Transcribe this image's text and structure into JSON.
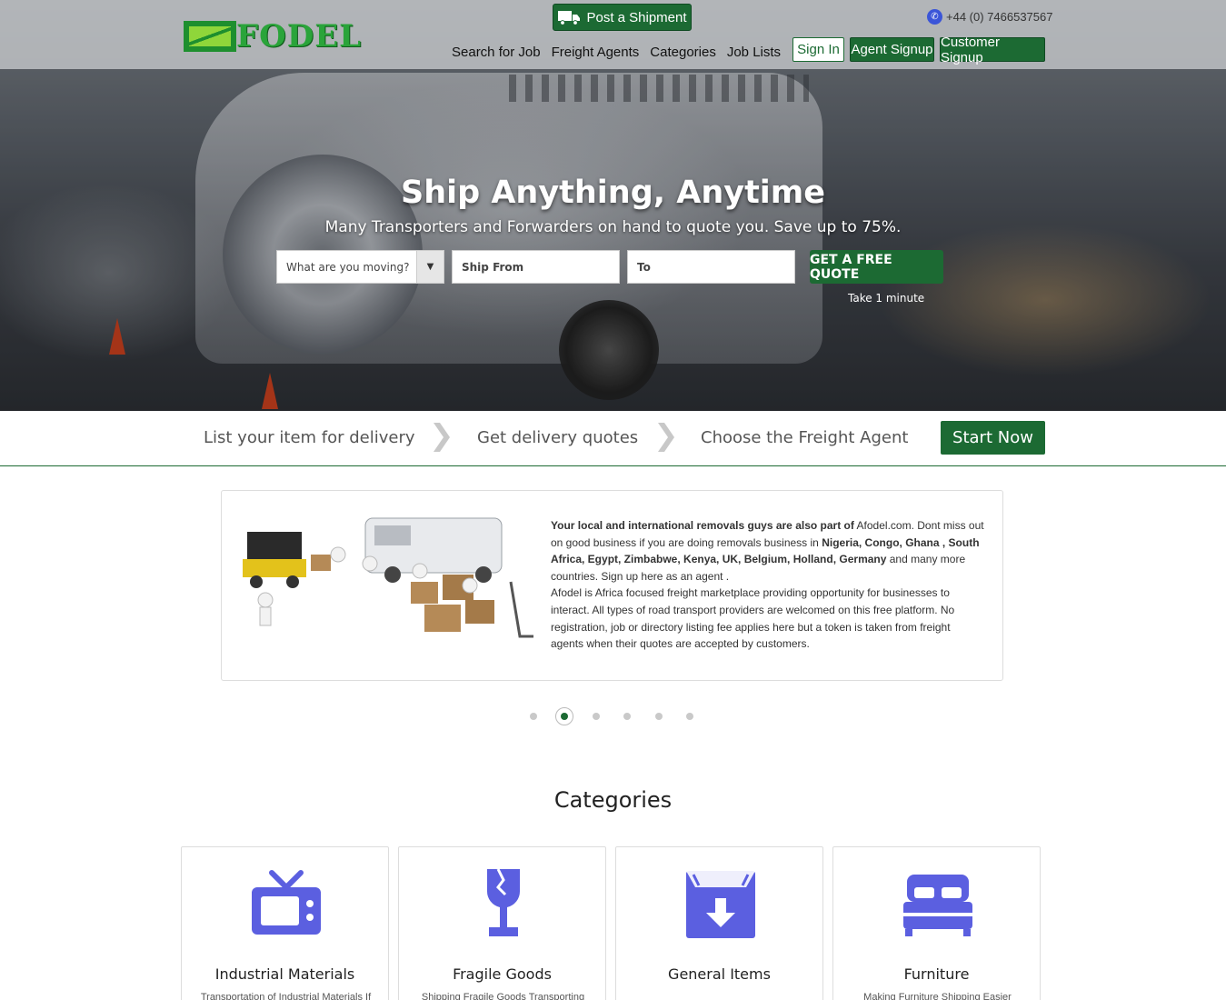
{
  "brand": {
    "logo_text": "FODEL"
  },
  "header": {
    "post_shipment_label": "Post a Shipment",
    "phone": "+44 (0) 7466537567",
    "nav": [
      "Search for Job",
      "Freight Agents",
      "Categories",
      "Job Lists"
    ],
    "sign_in": "Sign In",
    "agent_signup": "Agent Signup",
    "customer_signup": "Customer Signup"
  },
  "hero": {
    "title": "Ship Anything, Anytime",
    "subtitle": "Many Transporters and Forwarders on hand to quote you. Save up to 75%.",
    "moving_select": "What are you moving?",
    "ship_from_placeholder": "Ship From",
    "to_placeholder": "To",
    "quote_button": "GET A FREE QUOTE",
    "take_note": "Take 1 minute"
  },
  "steps": {
    "items": [
      "List your item for delivery",
      "Get delivery quotes",
      "Choose the Freight Agent"
    ],
    "start_button": "Start Now"
  },
  "carousel": {
    "para1_bold_a": "Your local and international removals guys are also part of",
    "para1_a": " Afodel.com. Dont miss out on good business if you are doing removals business in ",
    "para1_bold_b": "Nigeria, Congo, Ghana , South Africa, Egypt, Zimbabwe, Kenya, UK, Belgium, Holland, Germany",
    "para1_b": " and many more countries. Sign up here as an agent .",
    "para2": "Afodel is Africa focused freight marketplace providing opportunity for businesses to interact. All types of road transport providers are welcomed on this free platform. No registration, job or directory listing fee applies here but a token is taken from freight agents when their quotes are accepted by customers.",
    "slide_count": 6,
    "active_slide": 2
  },
  "categories": {
    "heading": "Categories",
    "items": [
      {
        "name": "Industrial Materials",
        "desc": "Transportation of Industrial Materials If",
        "icon": "tv-icon"
      },
      {
        "name": "Fragile Goods",
        "desc": "Shipping Fragile Goods Transporting",
        "icon": "broken-glass-icon"
      },
      {
        "name": "General Items",
        "desc": "",
        "icon": "box-download-icon"
      },
      {
        "name": "Furniture",
        "desc": "Making Furniture Shipping Easier",
        "icon": "bed-icon"
      }
    ],
    "icon_color": "#5b5fe0"
  },
  "colors": {
    "accent": "#1c6a33",
    "icon": "#5b5fe0"
  }
}
